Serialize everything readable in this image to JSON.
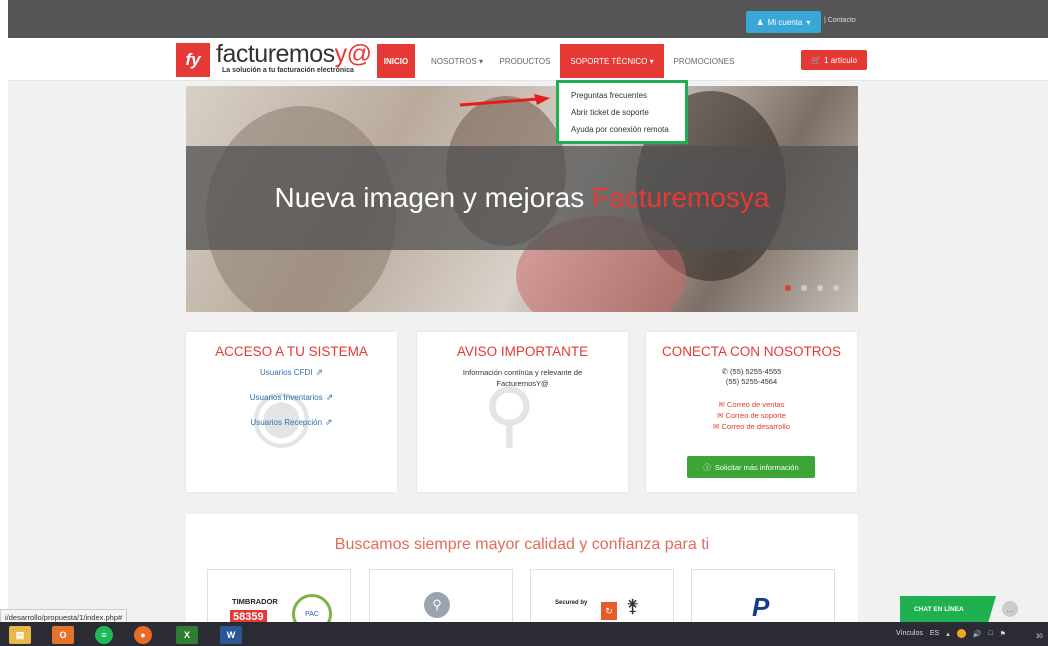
{
  "topbar": {
    "account_label": "Mi cuenta",
    "contact_label": "| Contacto"
  },
  "logo": {
    "brand_main": "facturemos",
    "brand_accent": "y@",
    "tagline": "La solución a tu facturación electrónica"
  },
  "nav": {
    "items": [
      "Inicio",
      "Nosotros",
      "Productos",
      "Soporte técnico",
      "Promociones"
    ],
    "cart_label": "1 artículo"
  },
  "dropdown": {
    "items": [
      "Preguntas frecuentes",
      "Abrir ticket de soporte",
      "Ayuda por conexión remota"
    ]
  },
  "hero": {
    "title_main": "Nueva imagen y mejoras ",
    "title_accent": "Facturemosya"
  },
  "cards": {
    "acceso": {
      "title": "ACCESO A TU SISTEMA",
      "links": [
        "Usuarios CFDI",
        "Usuarios Inventarios",
        "Usuarios Recepción"
      ]
    },
    "aviso": {
      "title": "AVISO IMPORTANTE",
      "text": "Información contínüa y relevante de FacturemosY@"
    },
    "conecta": {
      "title": "CONECTA CON NOSOTROS",
      "phone1": "(55) 5255-4555",
      "phone2": "(55) 5255-4564",
      "mails": [
        "Correo de ventas",
        "Correo de soporte",
        "Correo de desarrollo"
      ],
      "button": "Solicitar más información"
    }
  },
  "panel": {
    "title": "Buscamos siempre mayor calidad y confianza para ti",
    "timbrador_label": "TIMBRADOR",
    "timbrador_number": "58359",
    "seal_text": "PAC",
    "secured_label": "Secured by"
  },
  "status_url": "i/desarrollo/propuesta/1/index.php#",
  "chat": {
    "label": "CHAT EN LÍNEA"
  },
  "taskbar": {
    "tray_links": "Vínculos",
    "tray_lang": "ES",
    "clock": "30"
  }
}
